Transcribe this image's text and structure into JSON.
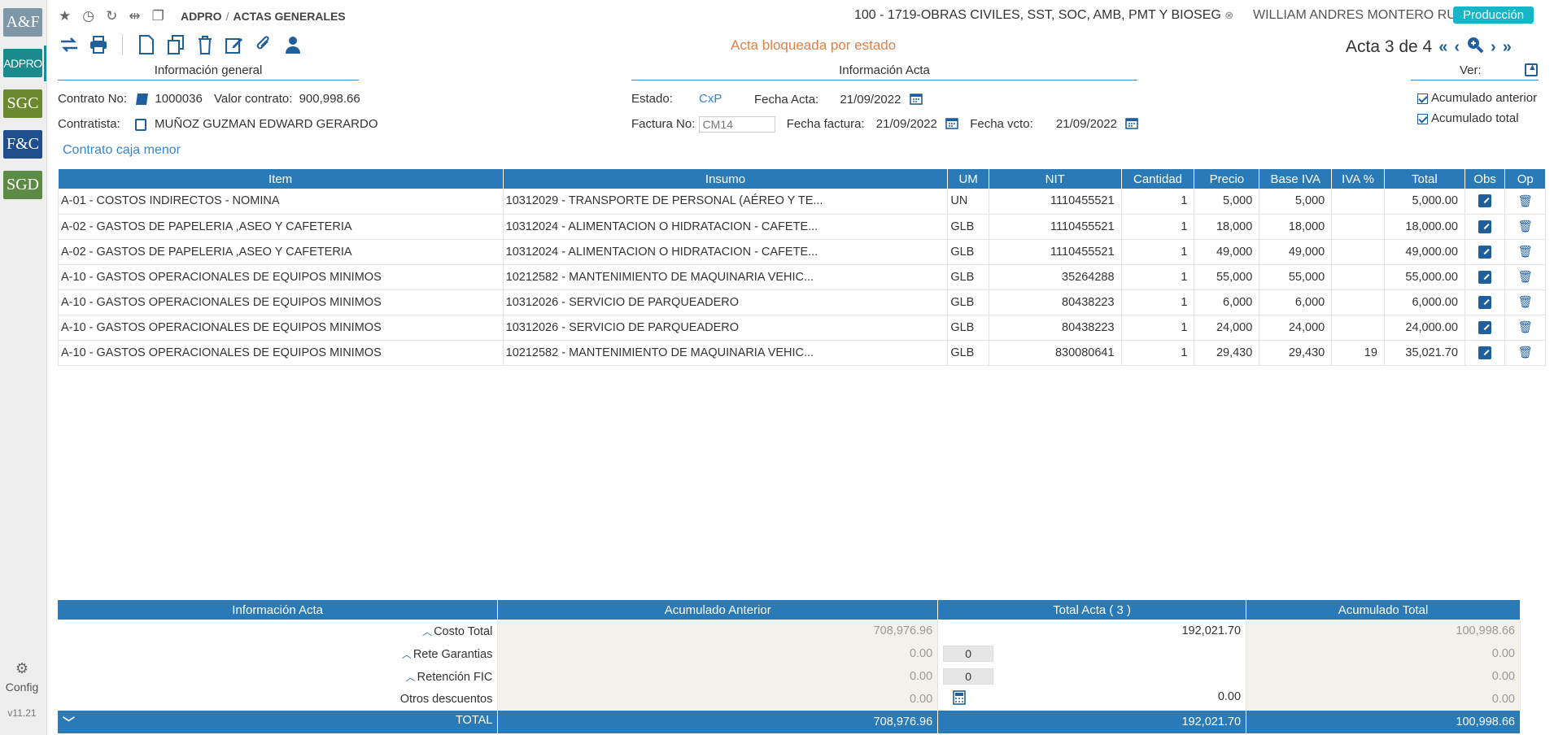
{
  "sidebar": {
    "modules": [
      "A&F",
      "ADPRO",
      "SGC",
      "F&C",
      "SGD"
    ],
    "config_label": "Config",
    "version": "v11.21"
  },
  "header": {
    "crumb_module": "ADPRO",
    "crumb_sep": "/",
    "crumb_page": "ACTAS GENERALES",
    "contract": "100 - 1719-OBRAS CIVILES, SST, SOC, AMB, PMT Y BIOSEG",
    "user": "WILLIAM ANDRES MONTERO RUIZ",
    "environment": "Producción"
  },
  "toolbar": {
    "locked_message": "Acta bloqueada por estado",
    "acta_label": "Acta 3 de 4"
  },
  "info_general": {
    "title": "Información general",
    "contrato_label": "Contrato No:",
    "contrato_value": "1000036",
    "valor_label": "Valor contrato:",
    "valor_value": "900,998.66",
    "contratista_label": "Contratista:",
    "contratista_value": "MUÑOZ GUZMAN EDWARD GERARDO",
    "caja_link": "Contrato caja menor"
  },
  "info_acta": {
    "title": "Información Acta",
    "estado_label": "Estado:",
    "estado_value": "CxP",
    "fecha_acta_label": "Fecha Acta:",
    "fecha_acta_value": "21/09/2022",
    "factura_label": "Factura No:",
    "factura_value": "CM14",
    "fecha_factura_label": "Fecha factura:",
    "fecha_factura_value": "21/09/2022",
    "fecha_vcto_label": "Fecha vcto:",
    "fecha_vcto_value": "21/09/2022"
  },
  "ver": {
    "title": "Ver:",
    "acum_anterior": "Acumulado anterior",
    "acum_total": "Acumulado total"
  },
  "items_table": {
    "headers": [
      "Item",
      "Insumo",
      "UM",
      "NIT",
      "Cantidad",
      "Precio",
      "Base IVA",
      "IVA %",
      "Total",
      "Obs",
      "Op"
    ],
    "rows": [
      [
        "A-01 - COSTOS INDIRECTOS - NOMINA",
        "10312029 - TRANSPORTE DE PERSONAL (AÉREO Y TE...",
        "UN",
        "1110455521",
        "1",
        "5,000",
        "5,000",
        "",
        "5,000.00"
      ],
      [
        "A-02 - GASTOS DE PAPELERIA ,ASEO Y CAFETERIA",
        "10312024 - ALIMENTACION O HIDRATACION - CAFETE...",
        "GLB",
        "1110455521",
        "1",
        "18,000",
        "18,000",
        "",
        "18,000.00"
      ],
      [
        "A-02 - GASTOS DE PAPELERIA ,ASEO Y CAFETERIA",
        "10312024 - ALIMENTACION O HIDRATACION - CAFETE...",
        "GLB",
        "1110455521",
        "1",
        "49,000",
        "49,000",
        "",
        "49,000.00"
      ],
      [
        "A-10 - GASTOS OPERACIONALES DE EQUIPOS MINIMOS",
        "10212582 - MANTENIMIENTO DE MAQUINARIA VEHIC...",
        "GLB",
        "35264288",
        "1",
        "55,000",
        "55,000",
        "",
        "55,000.00"
      ],
      [
        "A-10 - GASTOS OPERACIONALES DE EQUIPOS MINIMOS",
        "10312026 - SERVICIO DE PARQUEADERO",
        "GLB",
        "80438223",
        "1",
        "6,000",
        "6,000",
        "",
        "6,000.00"
      ],
      [
        "A-10 - GASTOS OPERACIONALES DE EQUIPOS MINIMOS",
        "10312026 - SERVICIO DE PARQUEADERO",
        "GLB",
        "80438223",
        "1",
        "24,000",
        "24,000",
        "",
        "24,000.00"
      ],
      [
        "A-10 - GASTOS OPERACIONALES DE EQUIPOS MINIMOS",
        "10212582 - MANTENIMIENTO DE MAQUINARIA VEHIC...",
        "GLB",
        "830080641",
        "1",
        "29,430",
        "29,430",
        "19",
        "35,021.70"
      ]
    ]
  },
  "summary": {
    "headers": [
      "Información Acta",
      "Acumulado Anterior",
      "Total Acta ( 3 )",
      "Acumulado Total"
    ],
    "rows": [
      {
        "label": "Costo Total",
        "anterior": "708,976.96",
        "actual": "192,021.70",
        "total": "100,998.66"
      },
      {
        "label": "Rete Garantias",
        "anterior": "0.00",
        "input": "0",
        "total": "0.00"
      },
      {
        "label": "Retención FIC",
        "anterior": "0.00",
        "input": "0",
        "total": "0.00"
      },
      {
        "label": "Otros descuentos",
        "anterior": "0.00",
        "actual": "0.00",
        "total": "0.00"
      }
    ],
    "total_row": {
      "label": "TOTAL",
      "anterior": "708,976.96",
      "actual": "192,021.70",
      "total": "100,998.66"
    }
  },
  "colors": {
    "primary": "#2a7ab8",
    "accent_link": "#3b86c6",
    "warning": "#d9824a",
    "env_badge": "#17b6c6"
  }
}
